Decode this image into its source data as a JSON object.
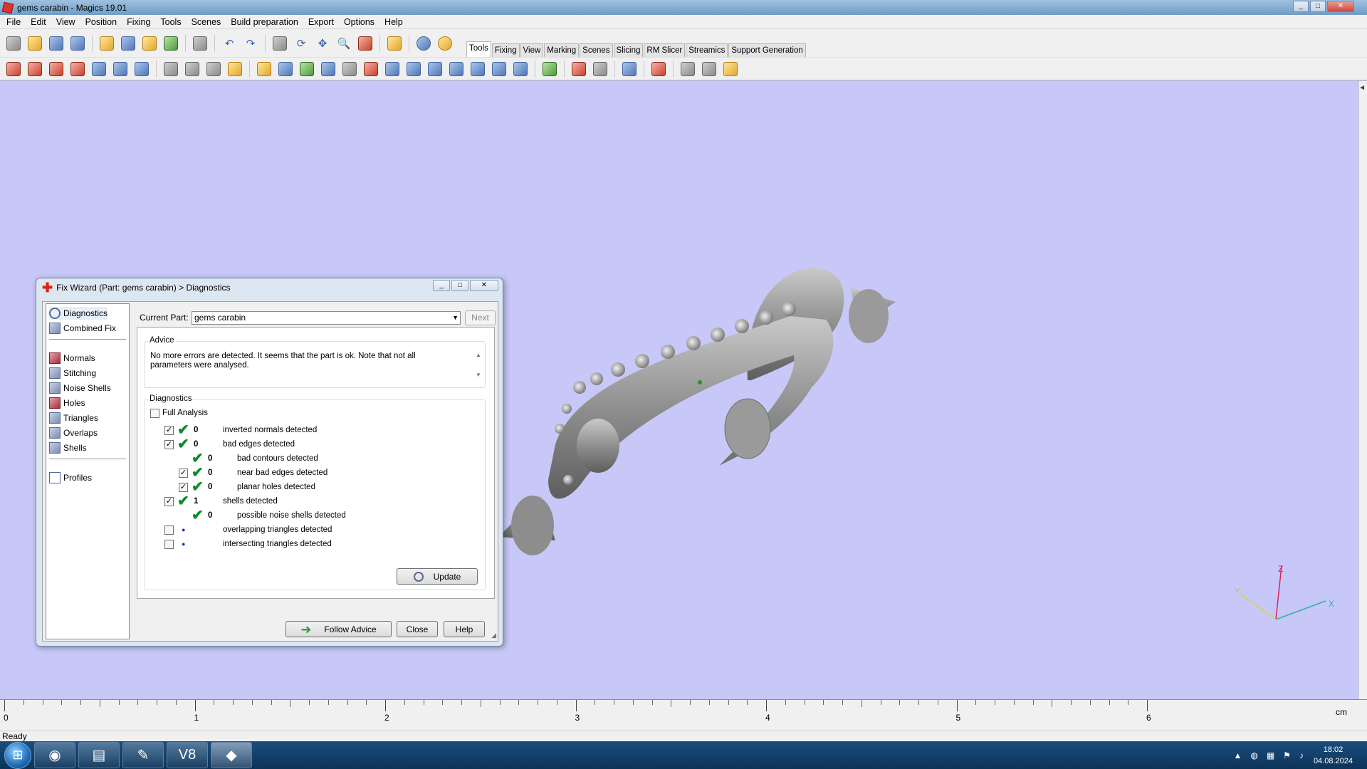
{
  "app": {
    "title": "gems carabin - Magics 19.01"
  },
  "menu": [
    "File",
    "Edit",
    "View",
    "Position",
    "Fixing",
    "Tools",
    "Scenes",
    "Build preparation",
    "Export",
    "Options",
    "Help"
  ],
  "tabs": [
    "Tools",
    "Fixing",
    "View",
    "Marking",
    "Scenes",
    "Slicing",
    "RM Slicer",
    "Streamics",
    "Support Generation"
  ],
  "active_tab": "Tools",
  "dialog": {
    "title": "Fix Wizard (Part: gems carabin) > Diagnostics",
    "nav": {
      "top": [
        "Diagnostics",
        "Combined Fix"
      ],
      "fixes": [
        "Normals",
        "Stitching",
        "Noise Shells",
        "Holes",
        "Triangles",
        "Overlaps",
        "Shells"
      ],
      "bottom": [
        "Profiles"
      ]
    },
    "current_part_label": "Current Part:",
    "current_part_value": "gems carabin",
    "next_label": "Next",
    "advice_legend": "Advice",
    "advice_text": "No more errors are detected. It seems that the part is ok. Note that not all parameters were analysed.",
    "diagnostics_legend": "Diagnostics",
    "full_analysis_label": "Full Analysis",
    "rows": [
      {
        "checked": true,
        "status": "ok",
        "count": "0",
        "text": "inverted normals detected",
        "level": 0,
        "hasBox": true
      },
      {
        "checked": true,
        "status": "ok",
        "count": "0",
        "text": "bad edges detected",
        "level": 0,
        "hasBox": true
      },
      {
        "checked": false,
        "status": "ok",
        "count": "0",
        "text": "bad contours detected",
        "level": 1,
        "hasBox": false
      },
      {
        "checked": true,
        "status": "ok",
        "count": "0",
        "text": "near bad edges detected",
        "level": 1,
        "hasBox": true
      },
      {
        "checked": true,
        "status": "ok",
        "count": "0",
        "text": "planar holes detected",
        "level": 1,
        "hasBox": true
      },
      {
        "checked": true,
        "status": "ok",
        "count": "1",
        "text": "shells detected",
        "level": 0,
        "hasBox": true
      },
      {
        "checked": false,
        "status": "ok",
        "count": "0",
        "text": "possible noise shells detected",
        "level": 1,
        "hasBox": false
      },
      {
        "checked": false,
        "status": "pending",
        "count": "",
        "text": "overlapping triangles detected",
        "level": 0,
        "hasBox": true
      },
      {
        "checked": false,
        "status": "pending",
        "count": "",
        "text": "intersecting triangles detected",
        "level": 0,
        "hasBox": true
      }
    ],
    "update_label": "Update",
    "follow_advice_label": "Follow Advice",
    "close_label": "Close",
    "help_label": "Help"
  },
  "axes": {
    "x": "X",
    "y": "Y",
    "z": "Z"
  },
  "ruler": {
    "labels": [
      "0",
      "1",
      "2",
      "3",
      "4",
      "5",
      "6"
    ],
    "unit": "cm"
  },
  "status": "Ready",
  "clock": {
    "time": "18:02",
    "date": "04.08.2024"
  },
  "colors": {
    "viewport": "#c8c8f8",
    "check": "#0d8a2d",
    "part": "#8c8c8c"
  }
}
